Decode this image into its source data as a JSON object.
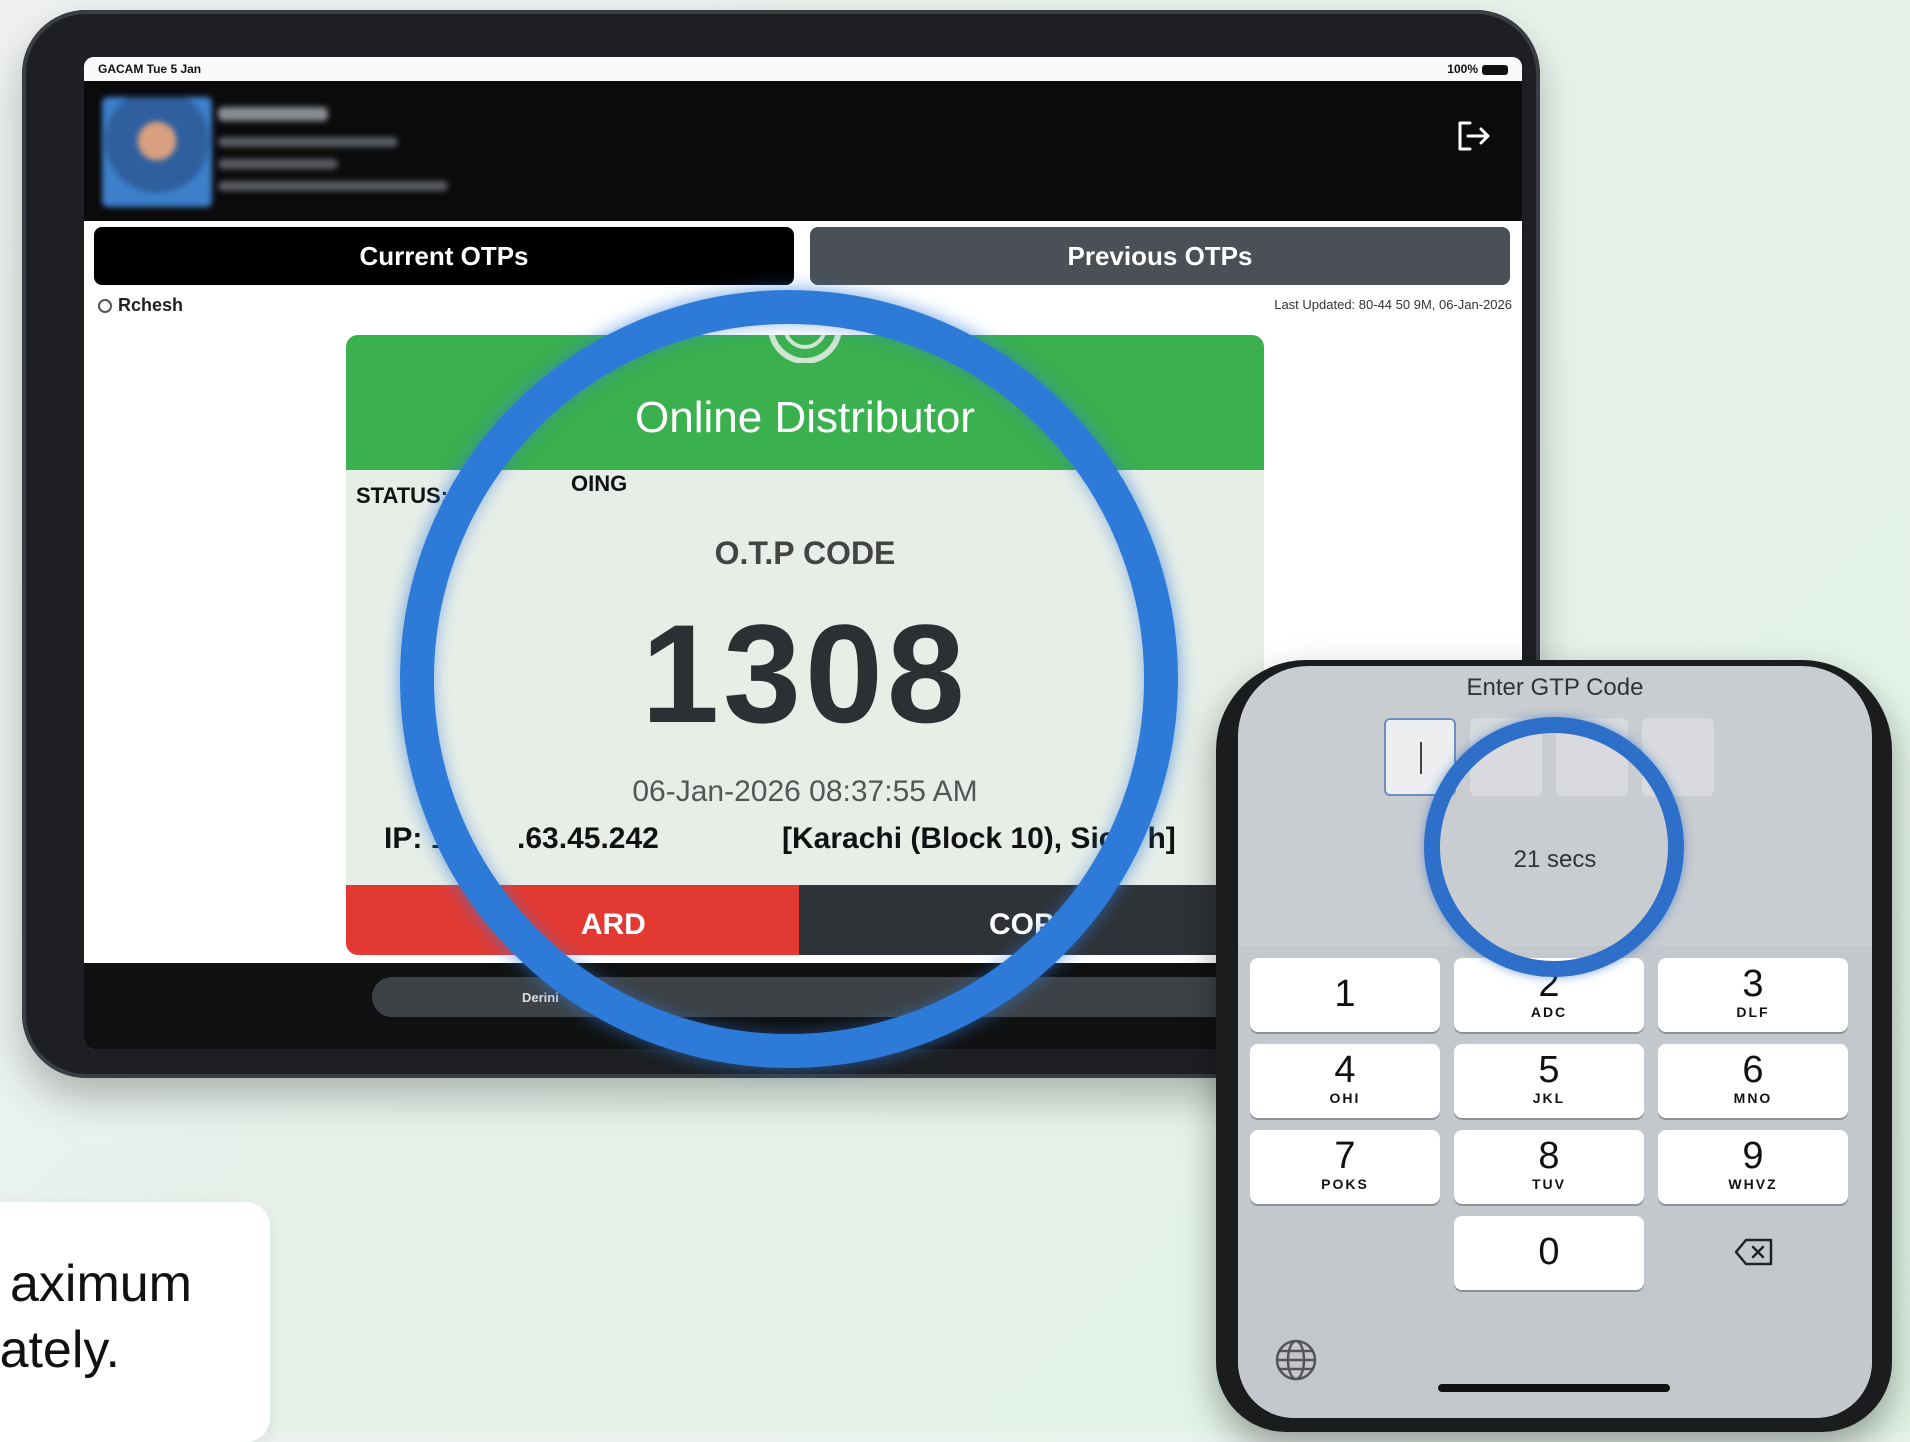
{
  "tablet": {
    "status_bar": {
      "left": "GACAM Tue 5 Jan",
      "right": "100%"
    },
    "tabs": {
      "current": "Current OTPs",
      "previous": "Previous OTPs"
    },
    "filter_user": "Rchesh",
    "last_updated": "Last Updated: 80-44 50 9M, 06-Jan-2026",
    "card": {
      "header_title": "Online Distributor",
      "status": "STATUS: PI",
      "status_tail": "OING",
      "otp_label": "O.T.P CODE",
      "otp_code": "1308",
      "timestamp": "06-Jan-2026 08:37:55 AM",
      "ip_prefix": "IP: 1C",
      "ip_suffix": ".63.45.242",
      "location": "[Karachi (Block 10), Sic",
      "location_tail": "h]",
      "discard_prefix": "B",
      "discard_suffix": "ARD",
      "copy_label": "COPY"
    },
    "bottom_pill_text": "Derini"
  },
  "phone": {
    "title": "Enter GTP Code",
    "first_box_value": "|",
    "timer": "21 secs",
    "keys": [
      {
        "n": "1",
        "s": ""
      },
      {
        "n": "2",
        "s": "ADC"
      },
      {
        "n": "3",
        "s": "DLF"
      },
      {
        "n": "4",
        "s": "OHI"
      },
      {
        "n": "5",
        "s": "JKL"
      },
      {
        "n": "6",
        "s": "MNO"
      },
      {
        "n": "7",
        "s": "POKS"
      },
      {
        "n": "8",
        "s": "TUV"
      },
      {
        "n": "9",
        "s": "WHVZ"
      },
      {
        "n": "0",
        "s": ""
      }
    ]
  },
  "note": {
    "line1": "aximum",
    "line2": "ately."
  },
  "colors": {
    "accent_green": "#3bb04f",
    "discard_red": "#e23a33",
    "ring_blue": "#2e7ad8"
  }
}
